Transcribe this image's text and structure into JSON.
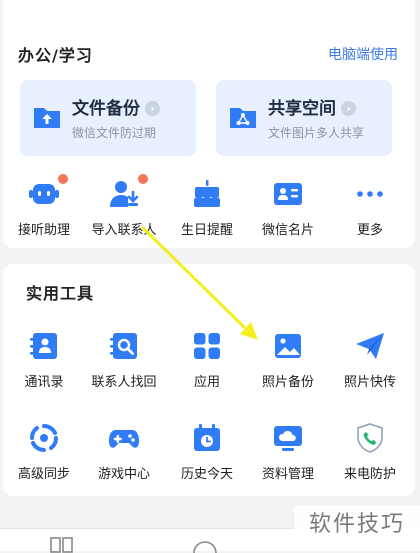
{
  "office": {
    "title": "办公/学习",
    "link": "电脑端使用",
    "features": [
      {
        "title": "文件备份",
        "subtitle": "微信文件防过期",
        "icon": "upload-folder-icon"
      },
      {
        "title": "共享空间",
        "subtitle": "文件图片多人共享",
        "icon": "share-folder-icon"
      }
    ],
    "items": [
      {
        "label": "接听助理",
        "icon": "robot-icon"
      },
      {
        "label": "导入联系人",
        "icon": "import-contacts-icon"
      },
      {
        "label": "生日提醒",
        "icon": "birthday-cake-icon"
      },
      {
        "label": "微信名片",
        "icon": "business-card-icon"
      },
      {
        "label": "更多",
        "icon": "more-icon"
      }
    ]
  },
  "tools": {
    "title": "实用工具",
    "row1": [
      {
        "label": "通讯录",
        "icon": "address-book-icon"
      },
      {
        "label": "联系人找回",
        "icon": "contact-recovery-icon"
      },
      {
        "label": "应用",
        "icon": "apps-grid-icon"
      },
      {
        "label": "照片备份",
        "icon": "photo-icon"
      },
      {
        "label": "照片快传",
        "icon": "paper-plane-icon"
      }
    ],
    "row2": [
      {
        "label": "高级同步",
        "icon": "sync-icon"
      },
      {
        "label": "游戏中心",
        "icon": "gamepad-icon"
      },
      {
        "label": "历史今天",
        "icon": "calendar-icon"
      },
      {
        "label": "资料管理",
        "icon": "cloud-monitor-icon"
      },
      {
        "label": "来电防护",
        "icon": "call-shield-icon"
      }
    ]
  },
  "watermark": "软件技巧",
  "colors": {
    "accent": "#3b7be0",
    "icon_blue": "#2f7cf6",
    "badge": "#f4735a",
    "arrow": "#f4ee1c"
  }
}
